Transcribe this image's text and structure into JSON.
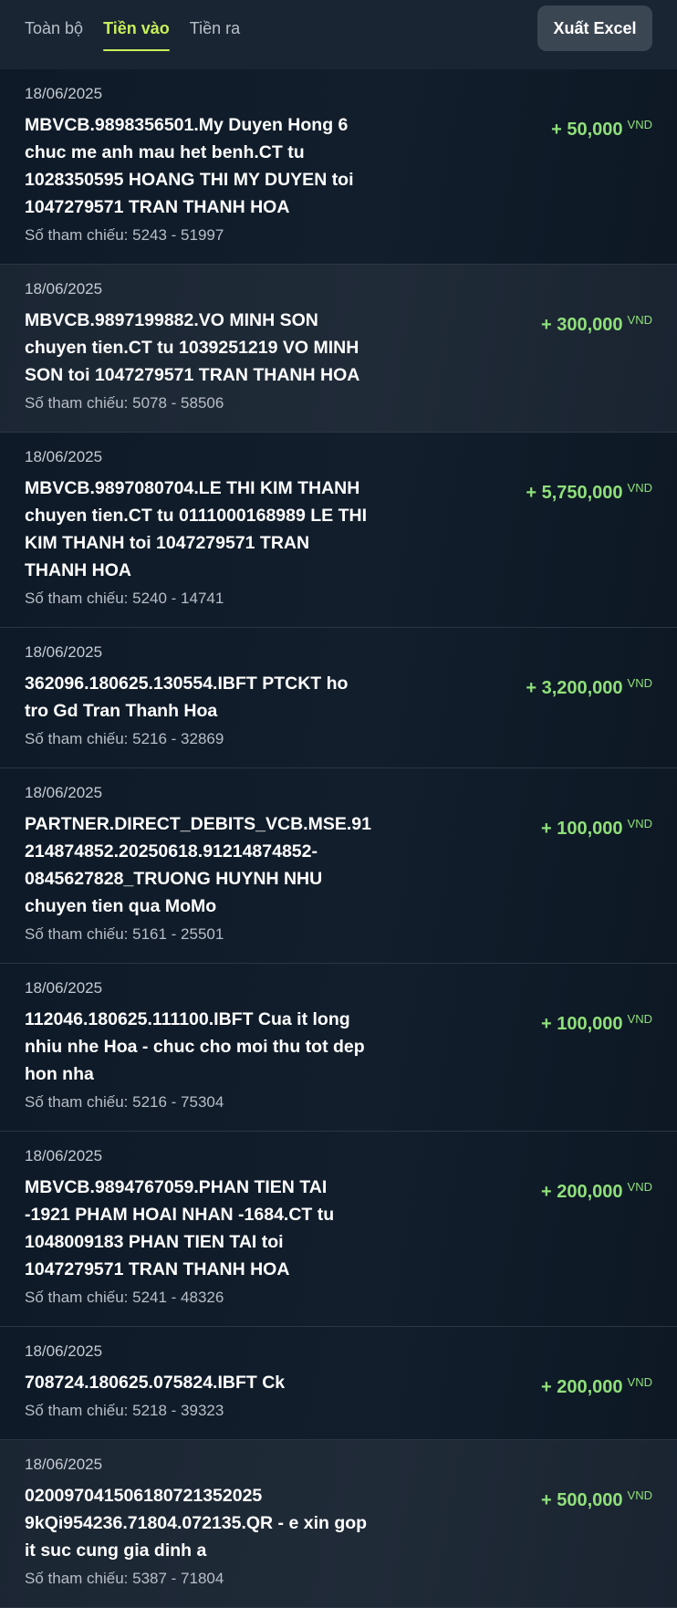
{
  "tabs": [
    {
      "label": "Toàn bộ",
      "active": false
    },
    {
      "label": "Tiền vào",
      "active": true
    },
    {
      "label": "Tiền ra",
      "active": false
    }
  ],
  "export_button": {
    "label": "Xuất Excel"
  },
  "colors": {
    "accent": "#c6f05a",
    "amount_positive": "#8fe07a",
    "background": "#0f1a26"
  },
  "transactions": [
    {
      "date": "18/06/2025",
      "description": "MBVCB.9898356501.My Duyen Hong 6 chuc me anh mau het benh.CT tu 1028350595 HOANG THI MY DUYEN toi 1047279571 TRAN THANH HOA",
      "reference": "Số tham chiếu: 5243 - 51997",
      "amount": "+ 50,000",
      "currency": "VND"
    },
    {
      "date": "18/06/2025",
      "description": "MBVCB.9897199882.VO MINH SON chuyen tien.CT tu 1039251219 VO MINH SON toi 1047279571 TRAN THANH HOA",
      "reference": "Số tham chiếu: 5078 - 58506",
      "amount": "+ 300,000",
      "currency": "VND"
    },
    {
      "date": "18/06/2025",
      "description": "MBVCB.9897080704.LE THI KIM THANH chuyen tien.CT tu 0111000168989 LE THI KIM THANH toi 1047279571 TRAN THANH HOA",
      "reference": "Số tham chiếu: 5240 - 14741",
      "amount": "+ 5,750,000",
      "currency": "VND"
    },
    {
      "date": "18/06/2025",
      "description": "362096.180625.130554.IBFT PTCKT ho tro Gd Tran Thanh Hoa",
      "reference": "Số tham chiếu: 5216 - 32869",
      "amount": "+ 3,200,000",
      "currency": "VND"
    },
    {
      "date": "18/06/2025",
      "description": "PARTNER.DIRECT_DEBITS_VCB.MSE.91214874852.20250618.91214874852-0845627828_TRUONG HUYNH NHU chuyen tien qua MoMo",
      "reference": "Số tham chiếu: 5161 - 25501",
      "amount": "+ 100,000",
      "currency": "VND"
    },
    {
      "date": "18/06/2025",
      "description": "112046.180625.111100.IBFT Cua it long nhiu nhe Hoa - chuc cho moi thu tot dep hon nha",
      "reference": "Số tham chiếu: 5216 - 75304",
      "amount": "+ 100,000",
      "currency": "VND"
    },
    {
      "date": "18/06/2025",
      "description": "MBVCB.9894767059.PHAN TIEN TAI -1921 PHAM HOAI NHAN -1684.CT tu 1048009183 PHAN TIEN TAI toi 1047279571 TRAN THANH HOA",
      "reference": "Số tham chiếu: 5241 - 48326",
      "amount": "+ 200,000",
      "currency": "VND"
    },
    {
      "date": "18/06/2025",
      "description": "708724.180625.075824.IBFT Ck",
      "reference": "Số tham chiếu: 5218 - 39323",
      "amount": "+ 200,000",
      "currency": "VND"
    },
    {
      "date": "18/06/2025",
      "description": "020097041506180721352025 9kQi954236.71804.072135.QR - e xin gop it suc cung gia dinh a",
      "reference": "Số tham chiếu: 5387 - 71804",
      "amount": "+ 500,000",
      "currency": "VND"
    }
  ]
}
